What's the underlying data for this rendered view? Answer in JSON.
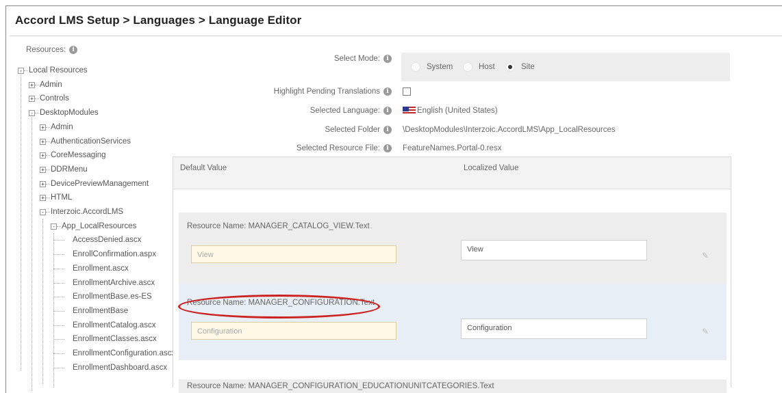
{
  "breadcrumb": "Accord LMS Setup > Languages > Language Editor",
  "resources": {
    "label": "Resources:",
    "tree": [
      {
        "label": "Local Resources",
        "toggle": "-"
      },
      {
        "label": "Admin",
        "toggle": "+"
      },
      {
        "label": "Controls",
        "toggle": "+"
      },
      {
        "label": "DesktopModules",
        "toggle": "-"
      },
      {
        "label": "Admin",
        "toggle": "+"
      },
      {
        "label": "AuthenticationServices",
        "toggle": "+"
      },
      {
        "label": "CoreMessaging",
        "toggle": "+"
      },
      {
        "label": "DDRMenu",
        "toggle": "+"
      },
      {
        "label": "DevicePreviewManagement",
        "toggle": "+"
      },
      {
        "label": "HTML",
        "toggle": "+"
      },
      {
        "label": "Interzoic.AccordLMS",
        "toggle": "-"
      },
      {
        "label": "App_LocalResources",
        "toggle": "-"
      },
      {
        "label": "AccessDenied.ascx"
      },
      {
        "label": "EnrollConfirmation.aspx"
      },
      {
        "label": "Enrollment.ascx"
      },
      {
        "label": "EnrollmentArchive.ascx"
      },
      {
        "label": "EnrollmentBase.es-ES"
      },
      {
        "label": "EnrollmentBase"
      },
      {
        "label": "EnrollmentCatalog.ascx"
      },
      {
        "label": "EnrollmentClasses.ascx"
      },
      {
        "label": "EnrollmentConfiguration.ascx"
      },
      {
        "label": "EnrollmentDashboard.ascx"
      }
    ]
  },
  "form": {
    "select_mode_label": "Select Mode:",
    "modes": [
      "System",
      "Host",
      "Site"
    ],
    "selected_mode": "Site",
    "highlight_label": "Highlight Pending Translations",
    "selected_language_label": "Selected Language:",
    "selected_language": "English (United States)",
    "selected_folder_label": "Selected Folder",
    "selected_folder": "\\DesktopModules\\Interzoic.AccordLMS\\App_LocalResources",
    "selected_file_label": "Selected Resource File:",
    "selected_file": "FeatureNames.Portal-0.resx",
    "info_glyph": "i"
  },
  "grid": {
    "col_default": "Default Value",
    "col_localized": "Localized Value",
    "rows": [
      {
        "resource_name": "Resource Name: MANAGER_CATALOG_VIEW.Text",
        "default": "View",
        "localized": "View"
      },
      {
        "resource_name": "Resource Name: MANAGER_CONFIGURATION.Text",
        "default": "Configuration",
        "localized": "Configuration"
      },
      {
        "resource_name": "Resource Name: MANAGER_CONFIGURATION_EDUCATIONUNITCATEGORIES.Text"
      }
    ]
  },
  "colors": {
    "highlight": "#cc2222",
    "selected_row": "#e8eef5"
  }
}
